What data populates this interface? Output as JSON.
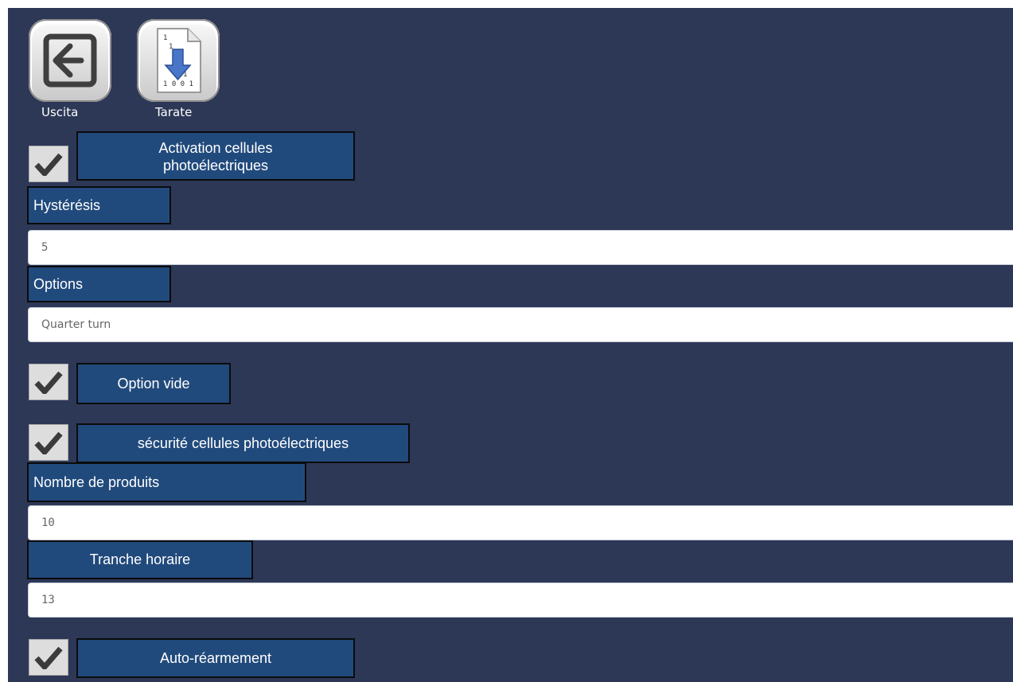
{
  "toolbar": {
    "exit_label": "Uscita",
    "tarate_label": "Tarate",
    "exit_icon": "exit-icon",
    "tarate_icon": "binary-download-icon",
    "tarate_icon_digits": [
      "1",
      "1",
      "0",
      "1",
      "1 0 0 1"
    ]
  },
  "form": {
    "activation_label": "Activation cellules photoélectriques",
    "hysteresis_label": "Hystérésis",
    "hysteresis_value": "5",
    "options_label": "Options",
    "options_value": "Quarter turn",
    "option_vide_label": "Option vide",
    "securite_label": "sécurité cellules photoélectriques",
    "nombre_label": "Nombre de produits",
    "nombre_value": "10",
    "tranche_label": "Tranche horaire",
    "tranche_value": "13",
    "auto_rearm_label": "Auto-réarmement",
    "checkbox_icon": "checkmark-icon"
  },
  "colors": {
    "background": "#2d3857",
    "label_background": "#214a7c",
    "label_border": "#0b0b0b",
    "field_text": "#666666"
  }
}
